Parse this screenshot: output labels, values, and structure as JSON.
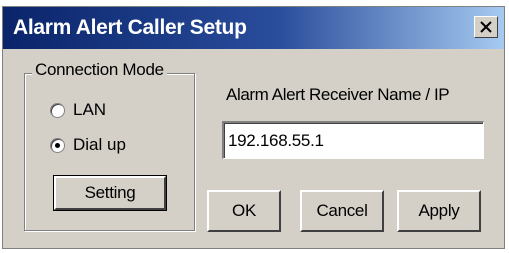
{
  "window": {
    "title": "Alarm Alert Caller Setup"
  },
  "connection_mode": {
    "legend": "Connection Mode",
    "options": [
      {
        "label": "LAN",
        "checked": false
      },
      {
        "label": "Dial up",
        "checked": true
      }
    ],
    "setting_label": "Setting"
  },
  "receiver": {
    "label": "Alarm Alert Receiver Name / IP",
    "value": "192.168.55.1"
  },
  "buttons": {
    "ok": "OK",
    "cancel": "Cancel",
    "apply": "Apply"
  },
  "colors": {
    "dialog_bg": "#d4d0c8",
    "titlebar_start": "#0a246a",
    "titlebar_end": "#a6caf0"
  }
}
